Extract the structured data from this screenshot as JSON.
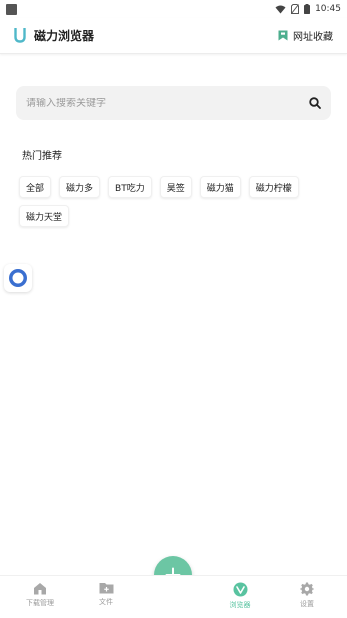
{
  "status_bar": {
    "time": "10:45"
  },
  "app_bar": {
    "title": "磁力浏览器",
    "bookmarks_label": "网址收藏"
  },
  "search": {
    "placeholder": "请输入搜索关键字",
    "value": ""
  },
  "hot": {
    "title": "热门推荐",
    "tags_row1": [
      "全部",
      "磁力多",
      "BT吃力",
      "昊签",
      "磁力猫",
      "磁力柠檬"
    ],
    "tags_row2": [
      "磁力天堂"
    ]
  },
  "bottom_nav": {
    "items": [
      {
        "label": "下载管理",
        "icon": "home-icon",
        "active": false
      },
      {
        "label": "文件",
        "icon": "folder-icon",
        "active": false
      },
      {
        "label": "浏览器",
        "icon": "browser-icon",
        "active": true
      },
      {
        "label": "设置",
        "icon": "gear-icon",
        "active": false
      }
    ],
    "fab_icon": "plus-icon"
  },
  "colors": {
    "accent": "#59c3a0",
    "fab": "#6cc6a4",
    "float_ring": "#3a6fd0"
  }
}
